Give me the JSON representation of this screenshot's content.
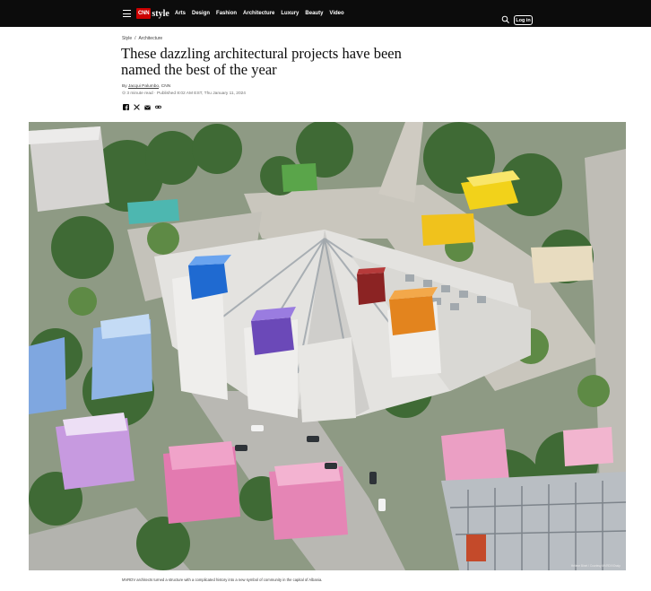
{
  "nav": {
    "logo_brand": "CNN",
    "logo_section": "style",
    "links": [
      "Arts",
      "Design",
      "Fashion",
      "Architecture",
      "Luxury",
      "Beauty",
      "Video"
    ],
    "login_label": "Log in",
    "menu_icon": "hamburger-menu-icon",
    "search_icon": "search-icon",
    "colors": {
      "bar": "#0c0c0c",
      "brand_red": "#cc0000"
    }
  },
  "article": {
    "breadcrumb": [
      "Style",
      "/",
      "Architecture"
    ],
    "headline": "These dazzling architectural projects have been named the best of the year",
    "byline_prefix": "By",
    "author": "Jacqui Palumbo",
    "outlet": ", CNN",
    "meta": "⊙ 3 minute read · Published 8:02 AM EST, Thu January 11, 2024",
    "share_icons": [
      "facebook-icon",
      "x-icon",
      "email-icon",
      "link-icon"
    ]
  },
  "hero": {
    "credit": "Hélène Binet / Courtesy MVRDV/Ossip",
    "caption": "MVRDV architects turned a structure with a complicated history into a new symbol of community in the capital of Albania."
  }
}
